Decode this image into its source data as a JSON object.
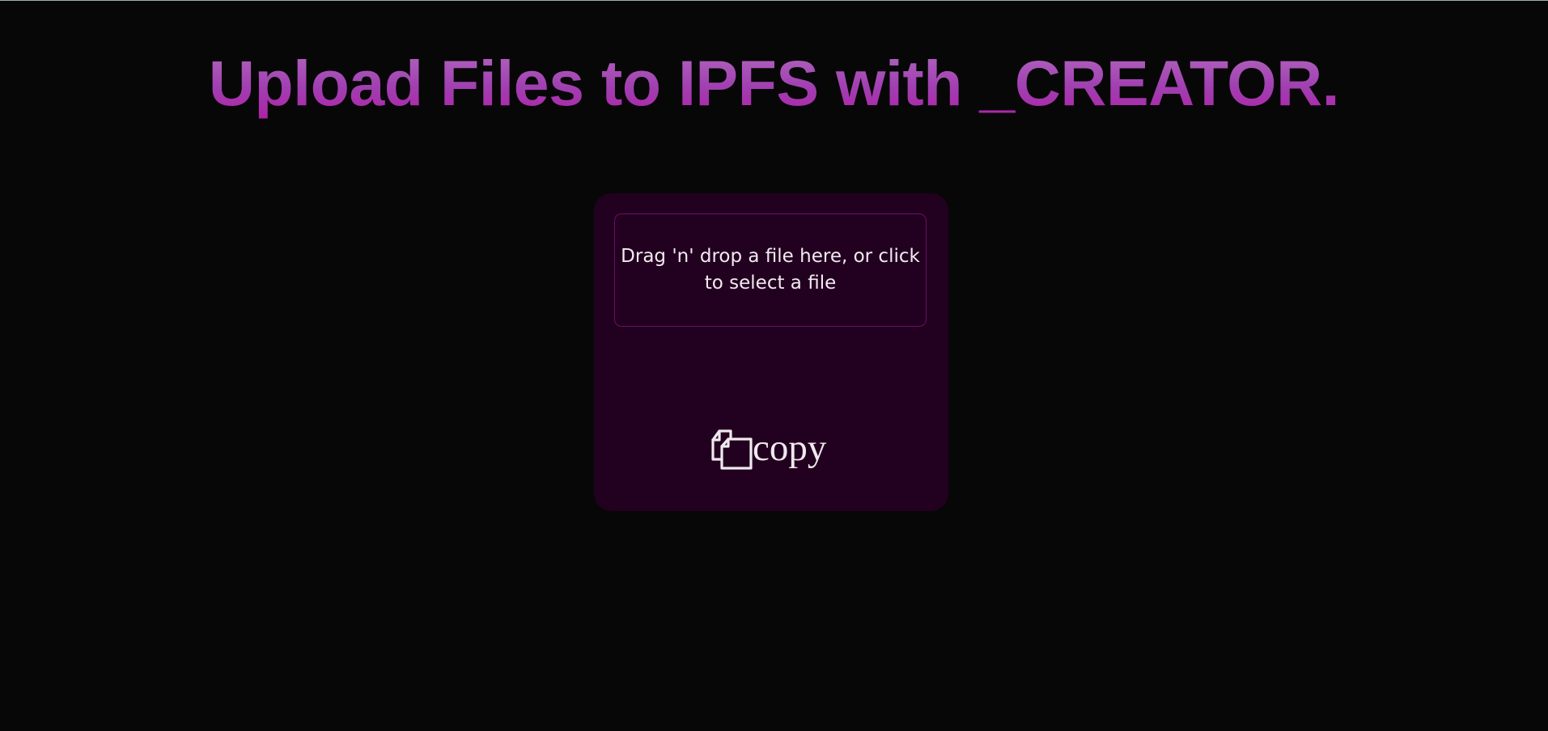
{
  "page": {
    "title": "Upload Files to IPFS with _CREATOR."
  },
  "uploader": {
    "dropzone_text": "Drag 'n' drop a file here, or click to select a file",
    "copy_label": "copy",
    "copy_icon": "copy-icon"
  },
  "colors": {
    "background": "#070707",
    "card": "#22001f",
    "dropzone_border": "#6b0e6a",
    "title_gradient_top": "#b36cc0",
    "title_gradient_bottom": "#b01fa6",
    "text": "#f3eaf2"
  }
}
